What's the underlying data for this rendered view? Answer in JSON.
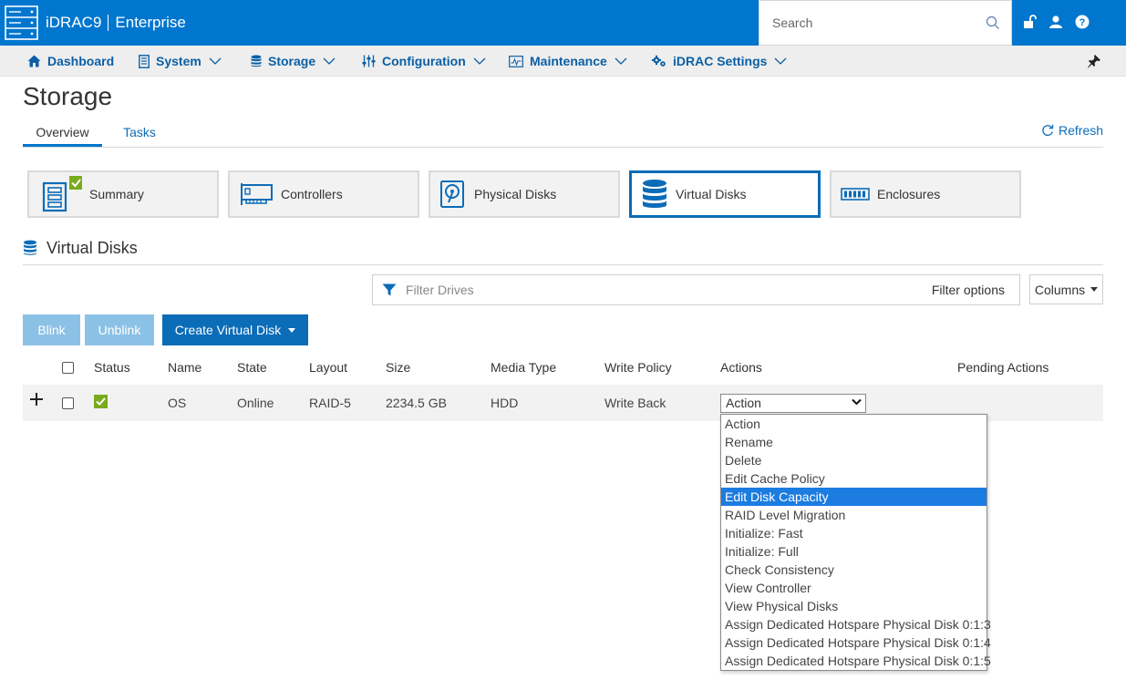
{
  "header": {
    "app_name": "iDRAC9",
    "edition": "Enterprise",
    "search_placeholder": "Search"
  },
  "nav": {
    "items": [
      {
        "label": "Dashboard",
        "icon": "home-icon"
      },
      {
        "label": "System",
        "icon": "server-icon"
      },
      {
        "label": "Storage",
        "icon": "database-icon"
      },
      {
        "label": "Configuration",
        "icon": "sliders-icon"
      },
      {
        "label": "Maintenance",
        "icon": "monitor-chart-icon"
      },
      {
        "label": "iDRAC Settings",
        "icon": "gears-icon"
      }
    ]
  },
  "page": {
    "title": "Storage",
    "tabs": [
      "Overview",
      "Tasks"
    ],
    "refresh_label": "Refresh"
  },
  "cards": [
    {
      "label": "Summary",
      "icon": "summary-icon"
    },
    {
      "label": "Controllers",
      "icon": "controller-card-icon"
    },
    {
      "label": "Physical Disks",
      "icon": "physical-disk-icon"
    },
    {
      "label": "Virtual Disks",
      "icon": "virtual-disk-icon"
    },
    {
      "label": "Enclosures",
      "icon": "enclosure-icon"
    }
  ],
  "section": {
    "title": "Virtual Disks",
    "filter_placeholder": "Filter Drives",
    "filter_options_label": "Filter options",
    "columns_label": "Columns"
  },
  "buttons": {
    "blink": "Blink",
    "unblink": "Unblink",
    "create": "Create Virtual Disk"
  },
  "table": {
    "headers": [
      "Status",
      "Name",
      "State",
      "Layout",
      "Size",
      "Media Type",
      "Write Policy",
      "Actions",
      "Pending Actions"
    ],
    "row": {
      "name": "OS",
      "state": "Online",
      "layout": "RAID-5",
      "size": "2234.5 GB",
      "media_type": "HDD",
      "write_policy": "Write Back",
      "action_selected": "Action"
    }
  },
  "action_menu": {
    "options": [
      "Action",
      "Rename",
      "Delete",
      "Edit Cache Policy",
      "Edit Disk Capacity",
      "RAID Level Migration",
      "Initialize: Fast",
      "Initialize: Full",
      "Check Consistency",
      "View Controller",
      "View Physical Disks",
      "Assign Dedicated Hotspare Physical Disk 0:1:3",
      "Assign Dedicated Hotspare Physical Disk 0:1:4",
      "Assign Dedicated Hotspare Physical Disk 0:1:5"
    ],
    "highlighted": "Edit Disk Capacity"
  },
  "colors": {
    "brand_blue": "#0076ce",
    "link_blue": "#0b6cb8",
    "status_ok": "#7aaa1e",
    "highlight": "#1c7ce0"
  }
}
